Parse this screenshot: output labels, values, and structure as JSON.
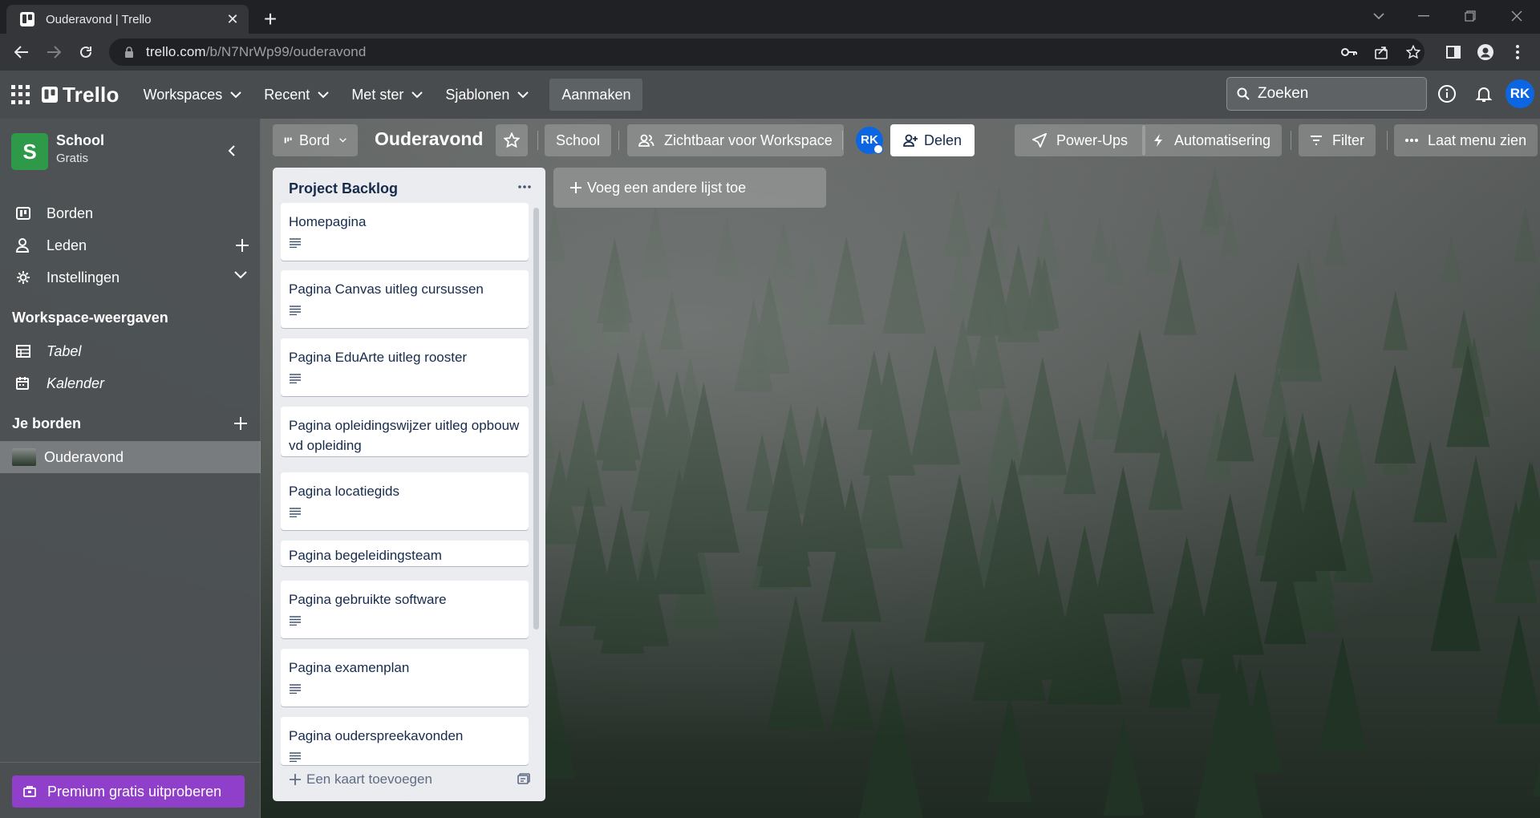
{
  "browser": {
    "tab_title": "Ouderavond | Trello",
    "url_host": "trello.com",
    "url_path": "/b/N7NrWp99/ouderavond"
  },
  "header": {
    "logo_text": "Trello",
    "nav": [
      "Workspaces",
      "Recent",
      "Met ster",
      "Sjablonen"
    ],
    "create_label": "Aanmaken",
    "search_placeholder": "Zoeken",
    "avatar_initials": "RK",
    "avatar_color": "#0c66e4"
  },
  "sidebar": {
    "workspace_initial": "S",
    "workspace_name": "School",
    "workspace_plan": "Gratis",
    "items": [
      "Borden",
      "Leden",
      "Instellingen"
    ],
    "views_heading": "Workspace-weergaven",
    "views": [
      "Tabel",
      "Kalender"
    ],
    "boards_heading": "Je borden",
    "boards": [
      "Ouderavond"
    ],
    "premium_label": "Premium gratis uitproberen"
  },
  "board": {
    "view_label": "Bord",
    "title": "Ouderavond",
    "workspace_label": "School",
    "visibility_label": "Zichtbaar voor Workspace",
    "member_initials": "RK",
    "share_label": "Delen",
    "powerups_label": "Power-Ups",
    "automation_label": "Automatisering",
    "filter_label": "Filter",
    "menu_label": "Laat menu zien"
  },
  "lists": [
    {
      "title": "Project Backlog",
      "add_card_label": "Een kaart toevoegen",
      "cards": [
        "Homepagina",
        "Pagina Canvas uitleg cursussen",
        "Pagina EduArte uitleg rooster",
        "Pagina opleidingswijzer uitleg opbouw vd opleiding",
        "Pagina locatiegids",
        "Pagina begeleidingsteam",
        "Pagina gebruikte software",
        "Pagina examenplan",
        "Pagina ouderspreekavonden"
      ]
    }
  ],
  "add_list_label": "Voeg een andere lijst toe"
}
